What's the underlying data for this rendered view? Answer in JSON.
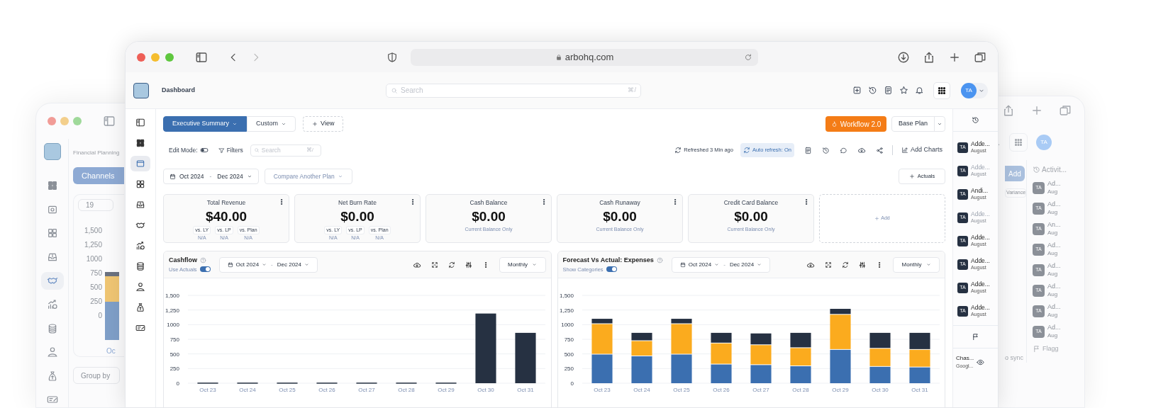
{
  "browser": {
    "url": "arbohq.com"
  },
  "header": {
    "title": "Dashboard",
    "search_placeholder": "Search",
    "search_shortcut": "⌘/",
    "avatar": "TA"
  },
  "sidebar": {
    "items": [
      {
        "kind": "panel",
        "selected": false
      },
      {
        "kind": "grid",
        "selected": false
      },
      {
        "kind": "card",
        "selected": true
      },
      {
        "kind": "grid4",
        "selected": false
      },
      {
        "kind": "inbox",
        "selected": false
      },
      {
        "kind": "handshake",
        "selected": false
      },
      {
        "kind": "growth",
        "selected": false
      },
      {
        "kind": "coins",
        "selected": false
      },
      {
        "kind": "person",
        "selected": false
      },
      {
        "kind": "bag",
        "selected": false
      },
      {
        "kind": "cheque",
        "selected": false
      }
    ]
  },
  "tabs": [
    {
      "label": "Executive Summary",
      "selected": true
    },
    {
      "label": "Custom",
      "selected": false
    }
  ],
  "add_view": "View",
  "workflow_button": "Workflow 2.0",
  "plan_select": "Base Plan",
  "toolbar": {
    "edit_mode": "Edit Mode:",
    "edit_mode_on": false,
    "filters": "Filters",
    "search_placeholder": "Search",
    "search_shortcut": "⌘/",
    "refreshed": "Refreshed 3 Min ago",
    "auto_refresh": "Auto refresh: On",
    "add_charts": "Add Charts"
  },
  "date_range": {
    "from": "Oct 2024",
    "separator": "-",
    "to": "Dec 2024"
  },
  "compare": "Compare Another Plan",
  "actuals_button": "Actuals",
  "kpis": [
    {
      "title": "Total Revenue",
      "value": "$40.00",
      "kind": "comparison",
      "comparisons": [
        {
          "label": "vs. LY",
          "value": "N/A"
        },
        {
          "label": "vs. LP",
          "value": "N/A"
        },
        {
          "label": "vs. Plan",
          "value": "N/A"
        }
      ]
    },
    {
      "title": "Net Burn Rate",
      "value": "$0.00",
      "kind": "comparison",
      "comparisons": [
        {
          "label": "vs. LY",
          "value": "N/A"
        },
        {
          "label": "vs. LP",
          "value": "N/A"
        },
        {
          "label": "vs. Plan",
          "value": "N/A"
        }
      ]
    },
    {
      "title": "Cash Balance",
      "value": "$0.00",
      "kind": "note",
      "note": "Current Balance Only"
    },
    {
      "title": "Cash Runaway",
      "value": "$0.00",
      "kind": "note",
      "note": "Current Balance Only"
    },
    {
      "title": "Credit Card Balance",
      "value": "$0.00",
      "kind": "note",
      "note": "Current Balance Only"
    }
  ],
  "add_card": "Add",
  "charts": [
    {
      "title": "Cashflow",
      "toggle_label": "Use Actuals",
      "toggle_on": true,
      "from": "Oct 2024",
      "separator": "-",
      "to": "Dec 2024",
      "period": "Monthly",
      "chart_data": {
        "type": "bar",
        "categories": [
          "Oct 23",
          "Oct 24",
          "Oct 25",
          "Oct 26",
          "Oct 27",
          "Oct 28",
          "Oct 29",
          "Oct 30",
          "Oct 31"
        ],
        "series": [
          {
            "color": "#263142",
            "values": [
              10,
              10,
              10,
              10,
              10,
              10,
              10,
              1190,
              860
            ]
          }
        ],
        "grid": true,
        "ylim": [
          0,
          1500
        ],
        "yticks": [
          0,
          250,
          500,
          750,
          {
            "value": 1000,
            "label": "1000"
          },
          {
            "value": 1250,
            "label": "1,250"
          },
          {
            "value": 1500,
            "label": "1,500"
          }
        ]
      }
    },
    {
      "title": "Forecast Vs Actual: Expenses",
      "toggle_label": "Show Categories",
      "toggle_on": true,
      "from": "Oct 2024",
      "separator": "-",
      "to": "Dec 2024",
      "period": "Monthly",
      "chart_data": {
        "type": "bar",
        "stacked": true,
        "categories": [
          "Oct 23",
          "Oct 24",
          "Oct 25",
          "Oct 26",
          "Oct 27",
          "Oct 28",
          "Oct 29",
          "Oct 30",
          "Oct 31"
        ],
        "series": [
          {
            "color": "#3b6fb0",
            "values": [
              490,
              460,
              490,
              320,
              310,
              290,
              570,
              280,
              270
            ]
          },
          {
            "color": "#fbab1e",
            "values": [
              520,
              260,
              520,
              360,
              340,
              310,
              600,
              310,
              300
            ]
          },
          {
            "color": "#263142",
            "values": [
              90,
              140,
              90,
              180,
              200,
              260,
              100,
              270,
              290
            ]
          }
        ],
        "grid": true,
        "ylim": [
          0,
          1500
        ],
        "yticks": [
          0,
          250,
          500,
          750,
          {
            "value": 1000,
            "label": "1000"
          },
          {
            "value": 1250,
            "label": "1,250"
          },
          {
            "value": 1500,
            "label": "1,500"
          }
        ]
      }
    }
  ],
  "activity": {
    "items": [
      {
        "avatar": "TA",
        "title": "Adde...",
        "date": "August",
        "muted": false
      },
      {
        "avatar": "TA",
        "title": "Adde...",
        "date": "August",
        "muted": true
      },
      {
        "avatar": "TA",
        "title": "Andi...",
        "date": "August",
        "muted": false
      },
      {
        "avatar": "TA",
        "title": "Adde...",
        "date": "August",
        "muted": true
      },
      {
        "avatar": "TA",
        "title": "Adde...",
        "date": "August",
        "muted": false
      },
      {
        "avatar": "TA",
        "title": "Adde...",
        "date": "August",
        "muted": false
      },
      {
        "avatar": "TA",
        "title": "Adde...",
        "date": "August",
        "muted": false
      },
      {
        "avatar": "TA",
        "title": "Adde...",
        "date": "August",
        "muted": false
      }
    ],
    "footer": {
      "title": "Chas...",
      "subtitle": "Googl..."
    }
  },
  "back_left_window": {
    "title": "Financial Planning",
    "tab": "Channels",
    "stepper_value": "19",
    "yticks": [
      "1,500",
      "1,250",
      "1000",
      "750",
      "500",
      "250",
      "0"
    ],
    "x_label": "Oc",
    "group_by": "Group by",
    "sidebar": [
      {
        "kind": "grid",
        "selected": false
      },
      {
        "kind": "camera",
        "selected": false
      },
      {
        "kind": "grid4",
        "selected": false
      },
      {
        "kind": "inbox",
        "selected": false
      },
      {
        "kind": "handshake",
        "selected": true
      },
      {
        "kind": "growth",
        "selected": false
      },
      {
        "kind": "coins",
        "selected": false
      },
      {
        "kind": "person",
        "selected": false
      },
      {
        "kind": "bag",
        "selected": false
      },
      {
        "kind": "cheque",
        "selected": false
      }
    ]
  },
  "back_right_window": {
    "avatar": "TA",
    "add_button": "Add",
    "column": "Variance",
    "sync_note": "o sync",
    "activity_title": "Activit...",
    "flagged": "Flagg",
    "items": [
      {
        "avatar": "TA",
        "title": "Ad...",
        "date": "Aug"
      },
      {
        "avatar": "TA",
        "title": "Ad...",
        "date": "Aug"
      },
      {
        "avatar": "TA",
        "title": "An...",
        "date": "Aug"
      },
      {
        "avatar": "TA",
        "title": "Ad...",
        "date": "Aug"
      },
      {
        "avatar": "TA",
        "title": "Ad...",
        "date": "Aug"
      },
      {
        "avatar": "TA",
        "title": "Ad...",
        "date": "Aug"
      },
      {
        "avatar": "TA",
        "title": "Ad...",
        "date": "Aug"
      },
      {
        "avatar": "TA",
        "title": "Ad...",
        "date": "Aug"
      }
    ]
  }
}
